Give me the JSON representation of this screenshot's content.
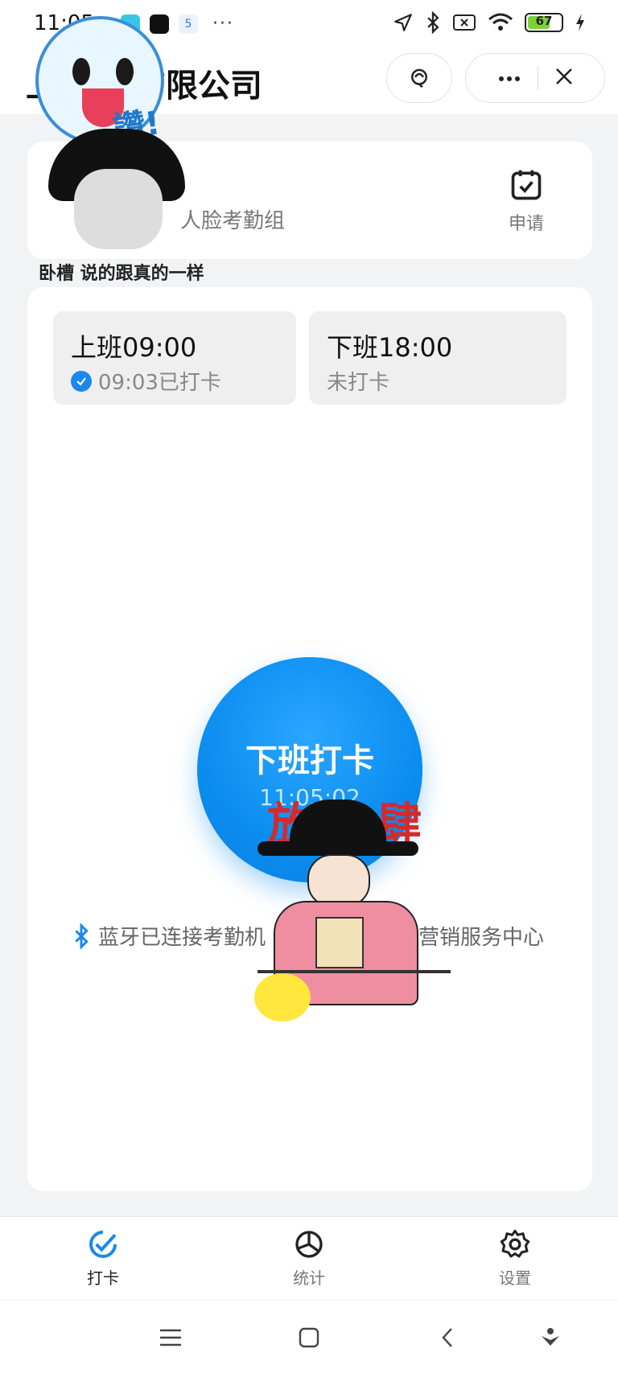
{
  "status_bar": {
    "time": "11:05",
    "notif_badge": "5",
    "more": "···",
    "battery_level": "67",
    "colors": {
      "battery_fill": "#7bd236"
    }
  },
  "app_bar": {
    "title": "上 科技有限公司",
    "icons": [
      "support-agent-icon",
      "more-icon",
      "close-icon"
    ]
  },
  "group_card": {
    "group_name": "人脸考勤组",
    "apply_label": "申请"
  },
  "shifts": [
    {
      "title": "上班09:00",
      "status": "09:03已打卡",
      "done": true
    },
    {
      "title": "下班18:00",
      "status": "未打卡",
      "done": false
    }
  ],
  "clock_button": {
    "label": "下班打卡",
    "time": "11:05:02",
    "color": "#0b8df0"
  },
  "bluetooth": {
    "status": "蓝牙已连接考勤机",
    "location": "营销服务中心"
  },
  "stickers": {
    "zan": "讚!",
    "caption": "卧槽 说的跟真的一样",
    "fang_si": "放肆"
  },
  "tab_bar": {
    "tabs": [
      {
        "label": "打卡",
        "icon": "check-icon",
        "active": true
      },
      {
        "label": "统计",
        "icon": "chart-icon",
        "active": false
      },
      {
        "label": "设置",
        "icon": "gear-icon",
        "active": false
      }
    ],
    "accent": "#1a88ee"
  },
  "system_nav": {
    "buttons": [
      "menu-icon",
      "home-icon",
      "back-icon",
      "assistant-icon"
    ]
  }
}
